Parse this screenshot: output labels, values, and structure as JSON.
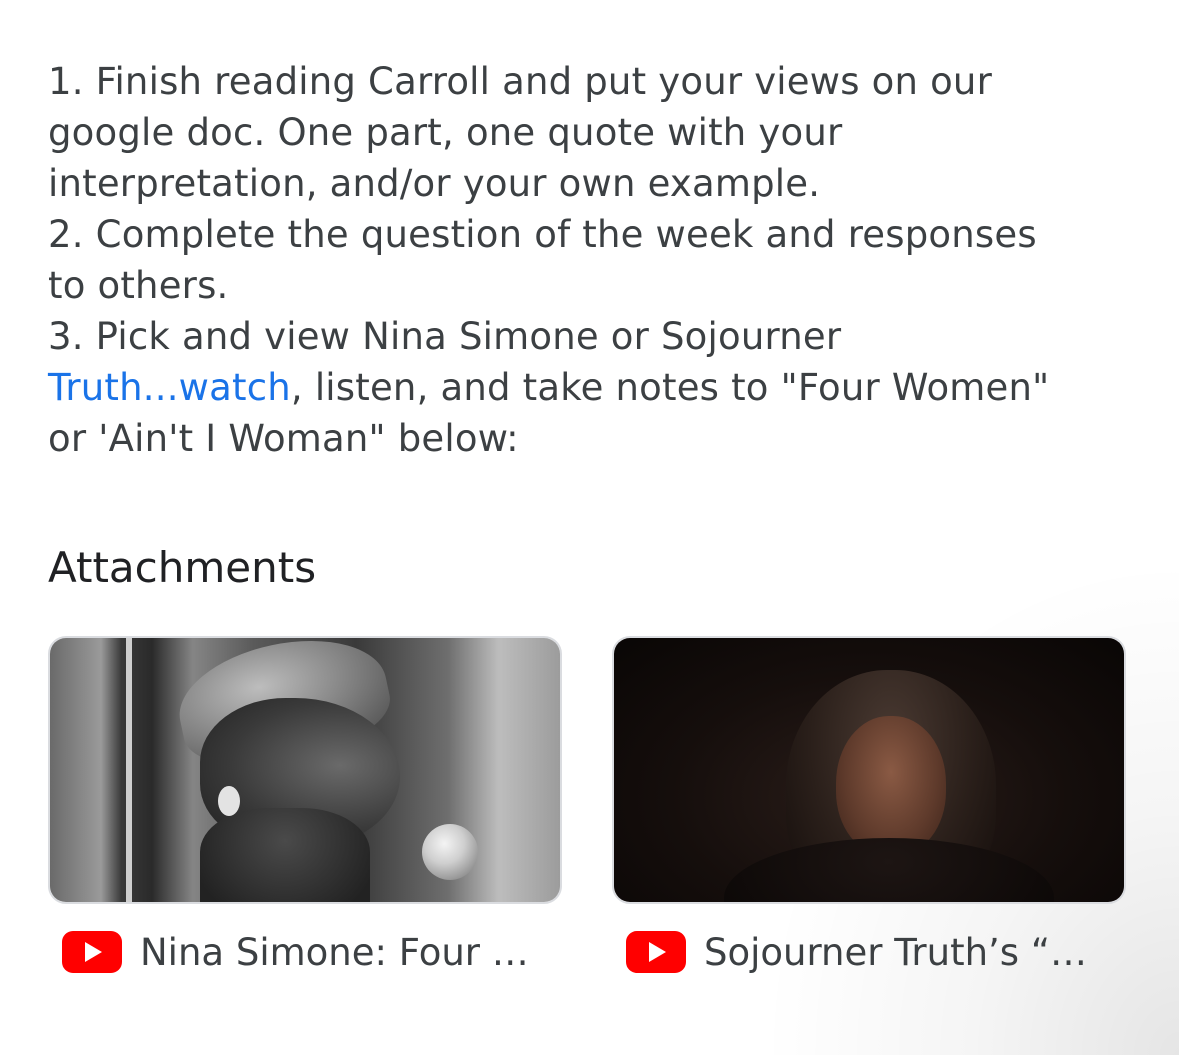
{
  "instructions": {
    "line1": "1. Finish reading Carroll and put your views on our",
    "line2": "google doc. One part, one quote with your",
    "line3": "interpretation, and/or your own example.",
    "line4": "2. Complete the question of the week and responses",
    "line5": "to others.",
    "line6": "3. Pick and view Nina Simone or Sojourner",
    "link_text": "Truth...watch",
    "line7_rest": ", listen, and take notes to \"Four Women\"",
    "line8": "or 'Ain't I Woman\" below:"
  },
  "attachments": {
    "heading": "Attachments",
    "items": [
      {
        "title": "Nina Simone: Four …",
        "icon": "youtube-icon"
      },
      {
        "title": "Sojourner Truth’s “…",
        "icon": "youtube-icon"
      }
    ]
  },
  "colors": {
    "link": "#1a73e8",
    "text": "#3c4043",
    "youtube_red": "#ff0000"
  }
}
